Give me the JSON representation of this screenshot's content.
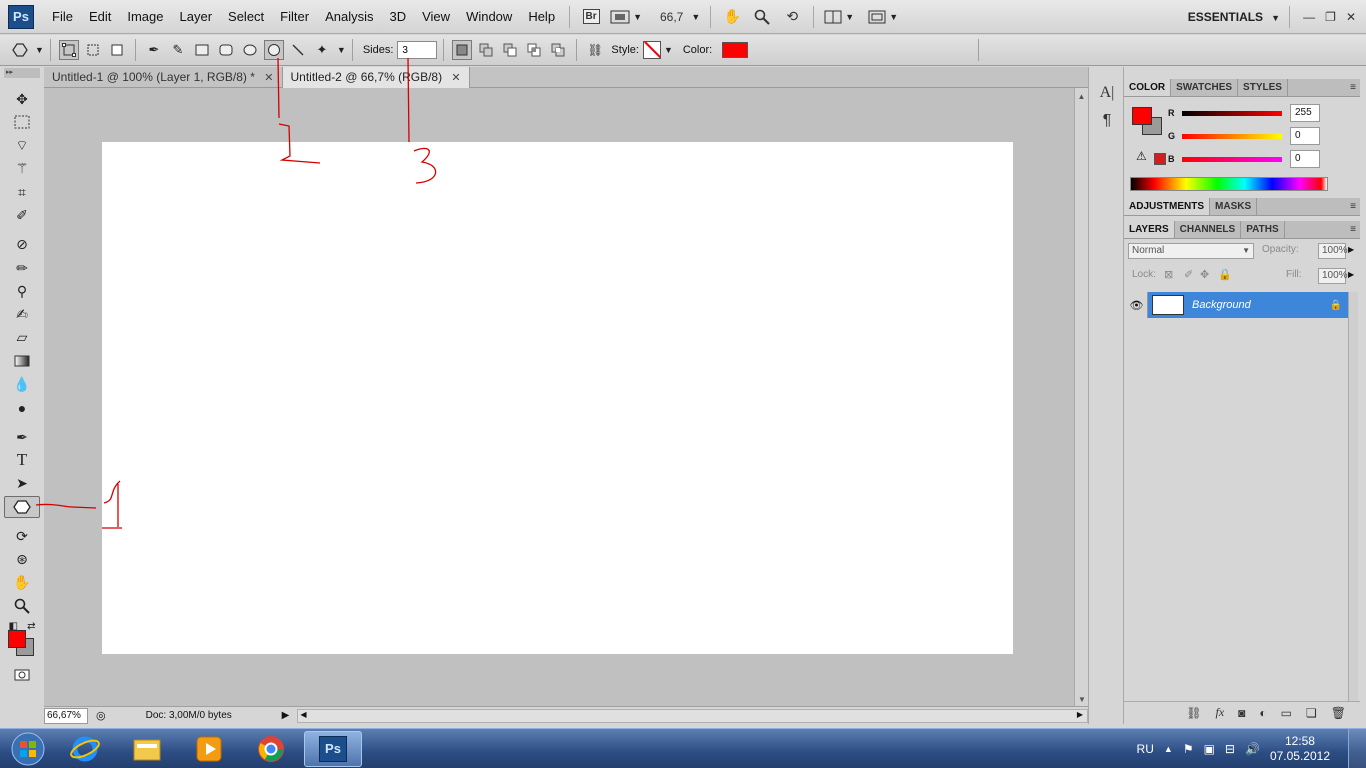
{
  "app": {
    "logo": "Ps",
    "menu": [
      "File",
      "Edit",
      "Image",
      "Layer",
      "Select",
      "Filter",
      "Analysis",
      "3D",
      "View",
      "Window",
      "Help"
    ],
    "bridge_label": "Br",
    "zoom_display": "66,7",
    "workspace": "ESSENTIALS"
  },
  "options": {
    "sides_label": "Sides:",
    "sides_value": "3",
    "style_label": "Style:",
    "color_label": "Color:",
    "shape_color": "#ff0000"
  },
  "tabs": [
    {
      "label": "Untitled-1 @ 100% (Layer 1, RGB/8) *",
      "close": "✕"
    },
    {
      "label": "Untitled-2 @ 66,7% (RGB/8)",
      "close": "✕"
    }
  ],
  "status": {
    "zoom": "66,67%",
    "doc": "Doc: 3,00M/0 bytes"
  },
  "tools": [
    "move",
    "marquee",
    "lasso",
    "quick-select",
    "crop",
    "eyedropper",
    "healing",
    "brush",
    "clone-stamp",
    "history-brush",
    "eraser",
    "gradient",
    "blur",
    "dodge",
    "pen",
    "type",
    "path-select",
    "polygon",
    "3d-rotate",
    "3d-orbit",
    "hand",
    "zoom"
  ],
  "colors": {
    "foreground": "#ff0000",
    "background": "#9b9b9b",
    "accent": "#3d86d9"
  },
  "color_panel": {
    "tabs": [
      "COLOR",
      "SWATCHES",
      "STYLES"
    ],
    "channels": [
      {
        "name": "R",
        "value": "255"
      },
      {
        "name": "G",
        "value": "0"
      },
      {
        "name": "B",
        "value": "0"
      }
    ]
  },
  "adjustments_panel": {
    "tabs": [
      "ADJUSTMENTS",
      "MASKS"
    ]
  },
  "layers_panel": {
    "tabs": [
      "LAYERS",
      "CHANNELS",
      "PATHS"
    ],
    "blend_mode": "Normal",
    "opacity_label": "Opacity:",
    "opacity_value": "100%",
    "lock_label": "Lock:",
    "fill_label": "Fill:",
    "fill_value": "100%",
    "layers": [
      {
        "name": "Background"
      }
    ]
  },
  "annotations": [
    "1",
    "2",
    "3"
  ],
  "taskbar": {
    "language": "RU",
    "time": "12:58",
    "date": "07.05.2012",
    "task_ps": "Ps"
  }
}
